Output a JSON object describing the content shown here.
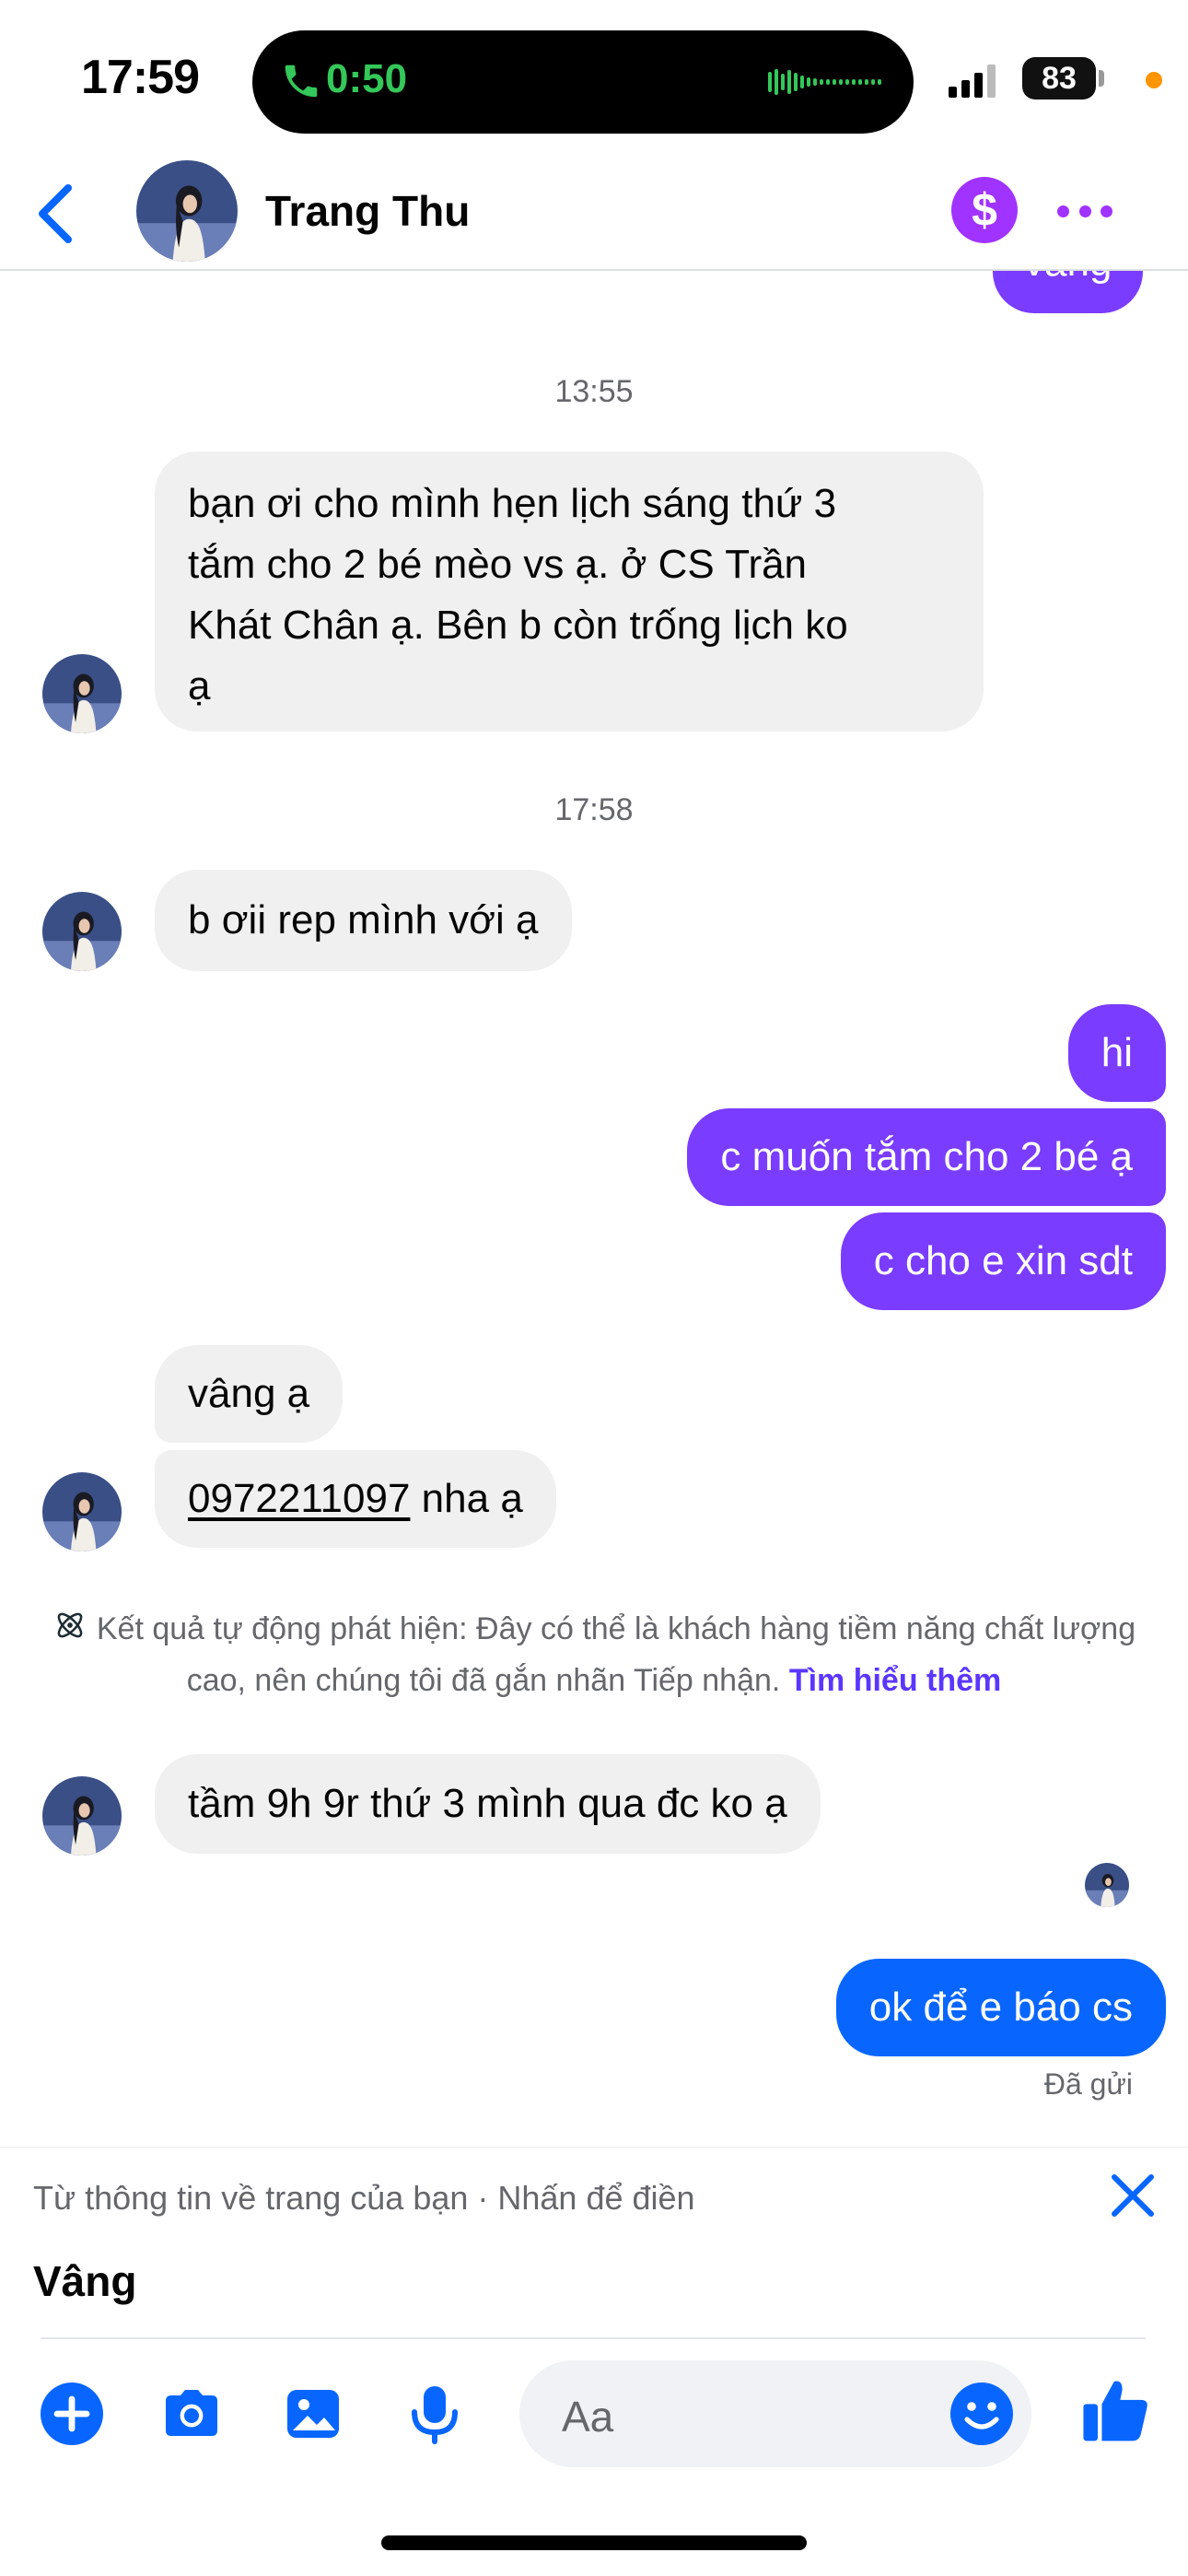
{
  "status_bar": {
    "time": "17:59",
    "call_timer": "0:50",
    "battery": "83"
  },
  "header": {
    "contact_name": "Trang Thu",
    "pay_icon": "$"
  },
  "messages": [
    {
      "type": "timestamp",
      "text": "13:55"
    },
    {
      "type": "incoming",
      "lines": [
        "bạn ơi cho mình hẹn lịch sáng thứ 3",
        "tắm cho 2 bé mèo vs ạ. ở CS Trần",
        "Khát Chân ạ. Bên b còn trống lịch ko",
        "ạ"
      ]
    },
    {
      "type": "timestamp",
      "text": "17:58"
    },
    {
      "type": "incoming",
      "text": "b ơii rep mình với ạ"
    },
    {
      "type": "outgoing",
      "text": "hi"
    },
    {
      "type": "outgoing",
      "text": "c muốn tắm cho 2 bé ạ"
    },
    {
      "type": "outgoing",
      "text": "c cho e xin sdt"
    },
    {
      "type": "incoming",
      "text": "vâng ạ"
    },
    {
      "type": "incoming",
      "phone": "0972211097",
      "suffix": " nha ạ"
    },
    {
      "type": "incoming",
      "text": "tầm 9h 9r thứ 3 mình qua đc ko ạ"
    },
    {
      "type": "outgoing",
      "text": "ok để e báo cs"
    }
  ],
  "partial_top_message": "vâng",
  "system_note": {
    "text": "Kết quả tự động phát hiện: Đây có thể là khách hàng tiềm năng chất lượng cao, nên chúng tôi đã gắn nhãn Tiếp nhận.",
    "link": "Tìm hiểu thêm"
  },
  "sent_status": "Đã gửi",
  "suggestion": {
    "hint": "Từ thông tin về trang của bạn · Nhấn để điền",
    "text": "Vâng"
  },
  "composer": {
    "placeholder": "Aa"
  },
  "colors": {
    "outgoing_purple": "#7a3cff",
    "outgoing_blue": "#0866ff",
    "incoming_bg": "#f0f0f0",
    "accent_blue": "#0866ff",
    "pay_purple": "#a033ff"
  }
}
